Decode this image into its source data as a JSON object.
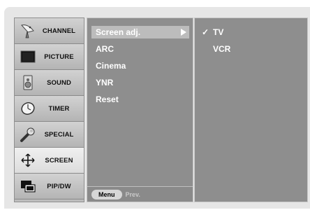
{
  "sidebar": {
    "items": [
      {
        "label": "CHANNEL",
        "icon": "satellite-dish-icon"
      },
      {
        "label": "PICTURE",
        "icon": "monitor-icon"
      },
      {
        "label": "SOUND",
        "icon": "speaker-icon"
      },
      {
        "label": "TIMER",
        "icon": "clock-icon"
      },
      {
        "label": "SPECIAL",
        "icon": "wrench-icon"
      },
      {
        "label": "SCREEN",
        "icon": "move-arrows-icon",
        "selected": true
      },
      {
        "label": "PIP/DW",
        "icon": "pip-windows-icon"
      }
    ]
  },
  "submenu": {
    "items": [
      {
        "label": "Screen adj.",
        "highlighted": true
      },
      {
        "label": "ARC"
      },
      {
        "label": "Cinema"
      },
      {
        "label": "YNR"
      },
      {
        "label": "Reset"
      }
    ],
    "footer": {
      "menu_label": "Menu",
      "prev_label": "Prev."
    }
  },
  "options": {
    "items": [
      {
        "label": "TV",
        "checked": true,
        "check_glyph": "✓"
      },
      {
        "label": "VCR",
        "checked": false,
        "check_glyph": ""
      }
    ]
  },
  "colors": {
    "panel": "#8e8e8e",
    "highlight": "#bcbcbc",
    "sidebar": "#bdbdbd",
    "selected_sidebar": "#e6e6e6"
  }
}
